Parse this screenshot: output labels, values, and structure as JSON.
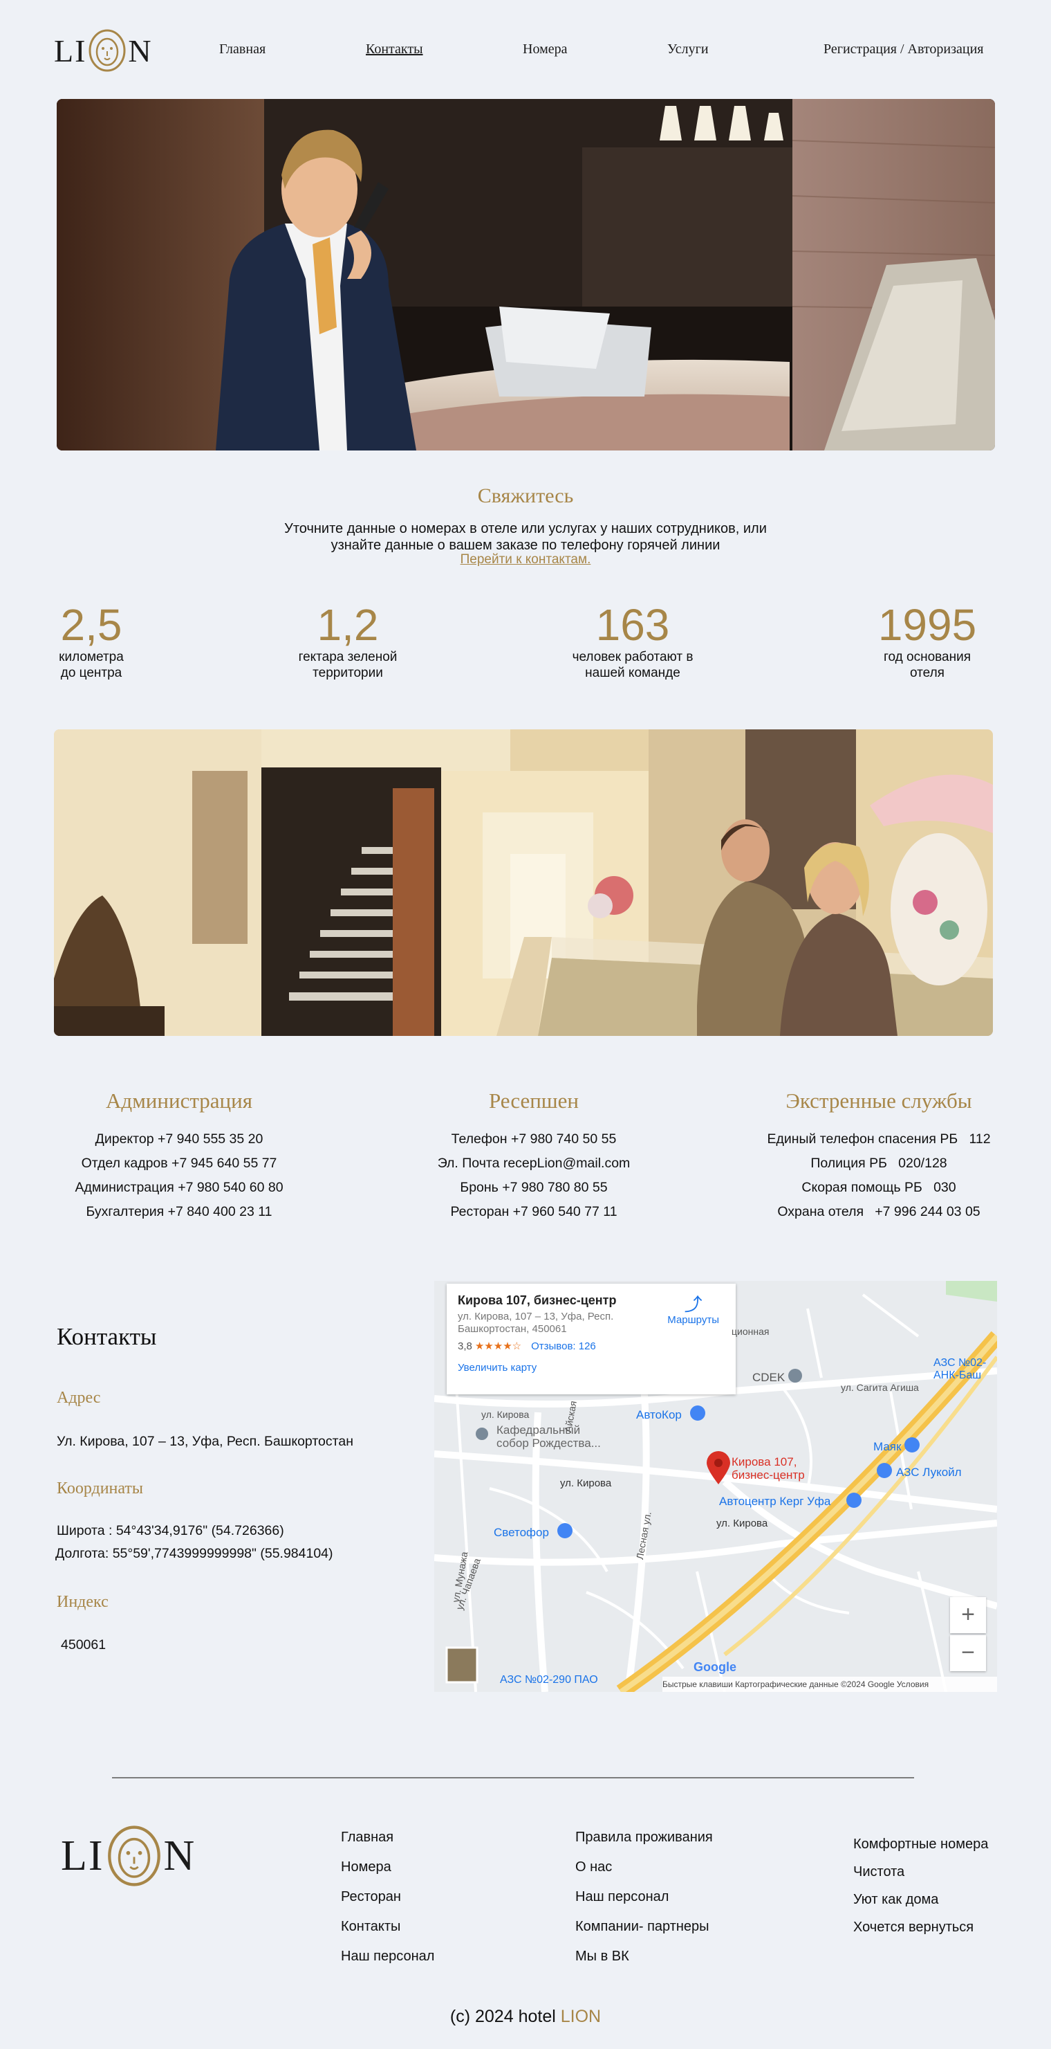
{
  "brand": {
    "left": "LI",
    "right": "N"
  },
  "nav": [
    {
      "label": "Главная"
    },
    {
      "label": "Контакты"
    },
    {
      "label": "Номера"
    },
    {
      "label": "Услуги"
    },
    {
      "label": "Регистрация / Авторизация"
    }
  ],
  "contact_intro": {
    "title": "Свяжитесь",
    "line1": "Уточните данные о номерах в отеле или услугах у наших сотрудников, или",
    "line2": "узнайте данные о вашем заказе по телефону горячей линии",
    "link": "Перейти к контактам."
  },
  "stats": [
    {
      "value": "2,5",
      "line1": "километра",
      "line2": "до центра"
    },
    {
      "value": "1,2",
      "line1": "гектара зеленой",
      "line2": "территории"
    },
    {
      "value": "163",
      "line1": "человек работают в",
      "line2": "нашей команде"
    },
    {
      "value": "1995",
      "line1": "год основания",
      "line2": "отеля"
    }
  ],
  "columns": [
    {
      "title": "Администрация",
      "lines": [
        "Директор +7 940 555 35 20",
        "Отдел кадров +7 945 640 55 77",
        "Администрация +7 980 540 60 80",
        "Бухгалтерия +7 840 400 23 11"
      ]
    },
    {
      "title": "Ресепшен",
      "lines": [
        "Телефон +7 980 740 50 55",
        "Эл. Почта recepLion@mail.com",
        "Бронь +7 980 780 80 55",
        "Ресторан +7 960 540 77 11"
      ]
    },
    {
      "title": "Экстренные службы",
      "lines": [
        "Единый телефон спасения РБ   112",
        "Полиция РБ   020/128",
        "Скорая помощь РБ   030",
        "Охрана отеля   +7 996 244 03 05"
      ]
    }
  ],
  "contacts": {
    "title": "Контакты",
    "address_h": "Адрес",
    "address": "Ул. Кирова, 107 – 13, Уфа, Респ. Башкортостан",
    "coords_h": "Координаты",
    "lat": "Широта : 54°43'34,9176\" (54.726366)",
    "lon": "Долгота: 55°59',7743999999998\" (55.984104)",
    "index_h": "Индекс",
    "index": "450061"
  },
  "map": {
    "card_title": "Кирова 107, бизнес-центр",
    "card_addr": "ул. Кирова, 107 – 13, Уфа, Респ. Башкортостан, 450061",
    "rating": "3,8",
    "stars": "★★★★☆",
    "reviews": "Отзывов: 126",
    "bigger": "Увеличить карту",
    "routes": "Маршруты",
    "pin_label1": "Кирова 107,",
    "pin_label2": "бизнес-центр",
    "places": {
      "cdek": "CDEK",
      "avtokor": "АвтоКор",
      "cathedral1": "Кафедральный",
      "cathedral2": "собор Рождества...",
      "svetofor": "Светофор",
      "mayak": "Маяк",
      "lukoil": "АЗС Лукойл",
      "kerg": "Автоцентр Керг Уфа",
      "azs1": "АЗС №02-",
      "azs2": "АНК-Баш",
      "azs_bottom": "АЗС №02-290 ПАО",
      "google": "Google"
    },
    "streets": {
      "kirova1": "ул. Кирова",
      "kirova2": "ул. Кирова",
      "kirova3": "ул. Кирова",
      "sagita": "ул. Сагита Агиша",
      "chapaeva": "ул. Чапаева",
      "lesnaya": "Лесная ул.",
      "aiskaya": "Айская",
      "nikaya": "ционная",
      "mingazh": "ул. Мунажа"
    },
    "footer": "Быстрые клавиши   Картографические данные ©2024 Google   Условия"
  },
  "footer": {
    "col1": [
      "Главная",
      "Номера",
      "Ресторан",
      "Контакты",
      "Наш персонал"
    ],
    "col2": [
      "Правила проживания",
      "О нас",
      "Наш персонал",
      "Компании- партнеры",
      "Мы в ВК"
    ],
    "col3": [
      "Комфортные номера",
      "Чистота",
      "Уют как дома",
      "Хочется вернуться"
    ],
    "copyright_prefix": "(c) 2024 hotel ",
    "copyright_brand": "LION"
  },
  "colors": {
    "accent": "#a78648",
    "background": "#eef1f6",
    "link_blue": "#1a73e8",
    "pin_red": "#d93025"
  }
}
